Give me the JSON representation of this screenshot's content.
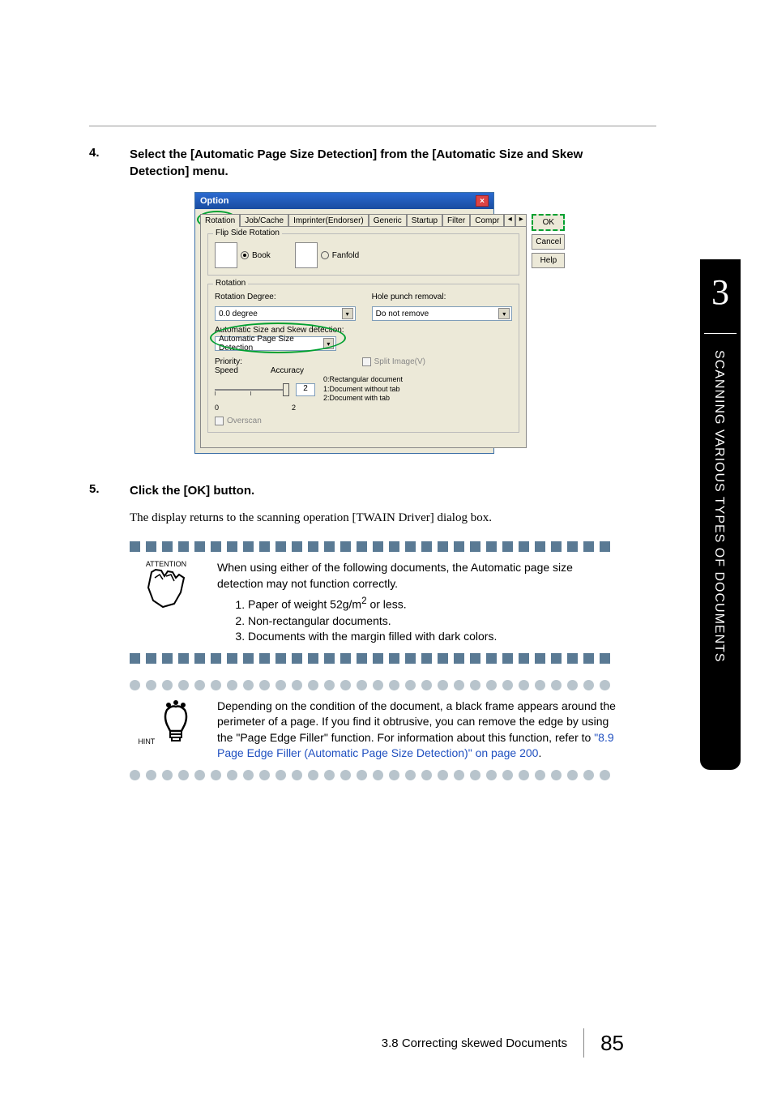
{
  "step4": {
    "num": "4.",
    "text": "Select the [Automatic Page Size Detection] from the [Automatic Size and Skew Detection] menu."
  },
  "dialog": {
    "title": "Option",
    "tabs": [
      "Rotation",
      "Job/Cache",
      "Imprinter(Endorser)",
      "Generic",
      "Startup",
      "Filter",
      "Compr"
    ],
    "buttons": {
      "ok": "OK",
      "cancel": "Cancel",
      "help": "Help"
    },
    "flip": {
      "group": "Flip Side Rotation",
      "book": "Book",
      "fanfold": "Fanfold"
    },
    "rotation": {
      "group": "Rotation",
      "degree_label": "Rotation Degree:",
      "degree_value": "0.0 degree",
      "hole_label": "Hole punch removal:",
      "hole_value": "Do not remove",
      "auto_label": "Automatic Size and Skew detection:",
      "auto_value": "Automatic Page Size Detection",
      "priority_label": "Priority:",
      "speed": "Speed",
      "accuracy": "Accuracy",
      "prio_value": "2",
      "scale_0": "0",
      "scale_2": "2",
      "split_label": "Split Image(V)",
      "legend0": "0:Rectangular document",
      "legend1": "1:Document without tab",
      "legend2": "2:Document with tab",
      "overscan": "Overscan"
    }
  },
  "step5": {
    "num": "5.",
    "text": "Click the [OK] button.",
    "body": "The display returns to the scanning operation [TWAIN Driver] dialog box."
  },
  "attention": {
    "label": "ATTENTION",
    "intro": "When using either of the following documents, the Automatic page size detection may not function correctly.",
    "item1_pre": "Paper of weight 52g/m",
    "item1_sup": "2",
    "item1_post": " or less.",
    "item2": "Non-rectangular documents.",
    "item3": "Documents with the margin filled with dark colors."
  },
  "hint": {
    "label": "HINT",
    "text_pre": "Depending on the condition of the document, a black frame appears around the perimeter of a page. If you find it obtrusive, you can remove the edge by using the \"Page Edge Filler\" function.  For information about this function, refer to ",
    "link": "\"8.9 Page Edge Filler (Automatic Page Size Detection)\" on page 200",
    "text_post": "."
  },
  "side": {
    "num": "3",
    "text": "SCANNING VARIOUS TYPES OF DOCUMENTS"
  },
  "footer": {
    "section": "3.8 Correcting skewed Documents",
    "page": "85"
  }
}
